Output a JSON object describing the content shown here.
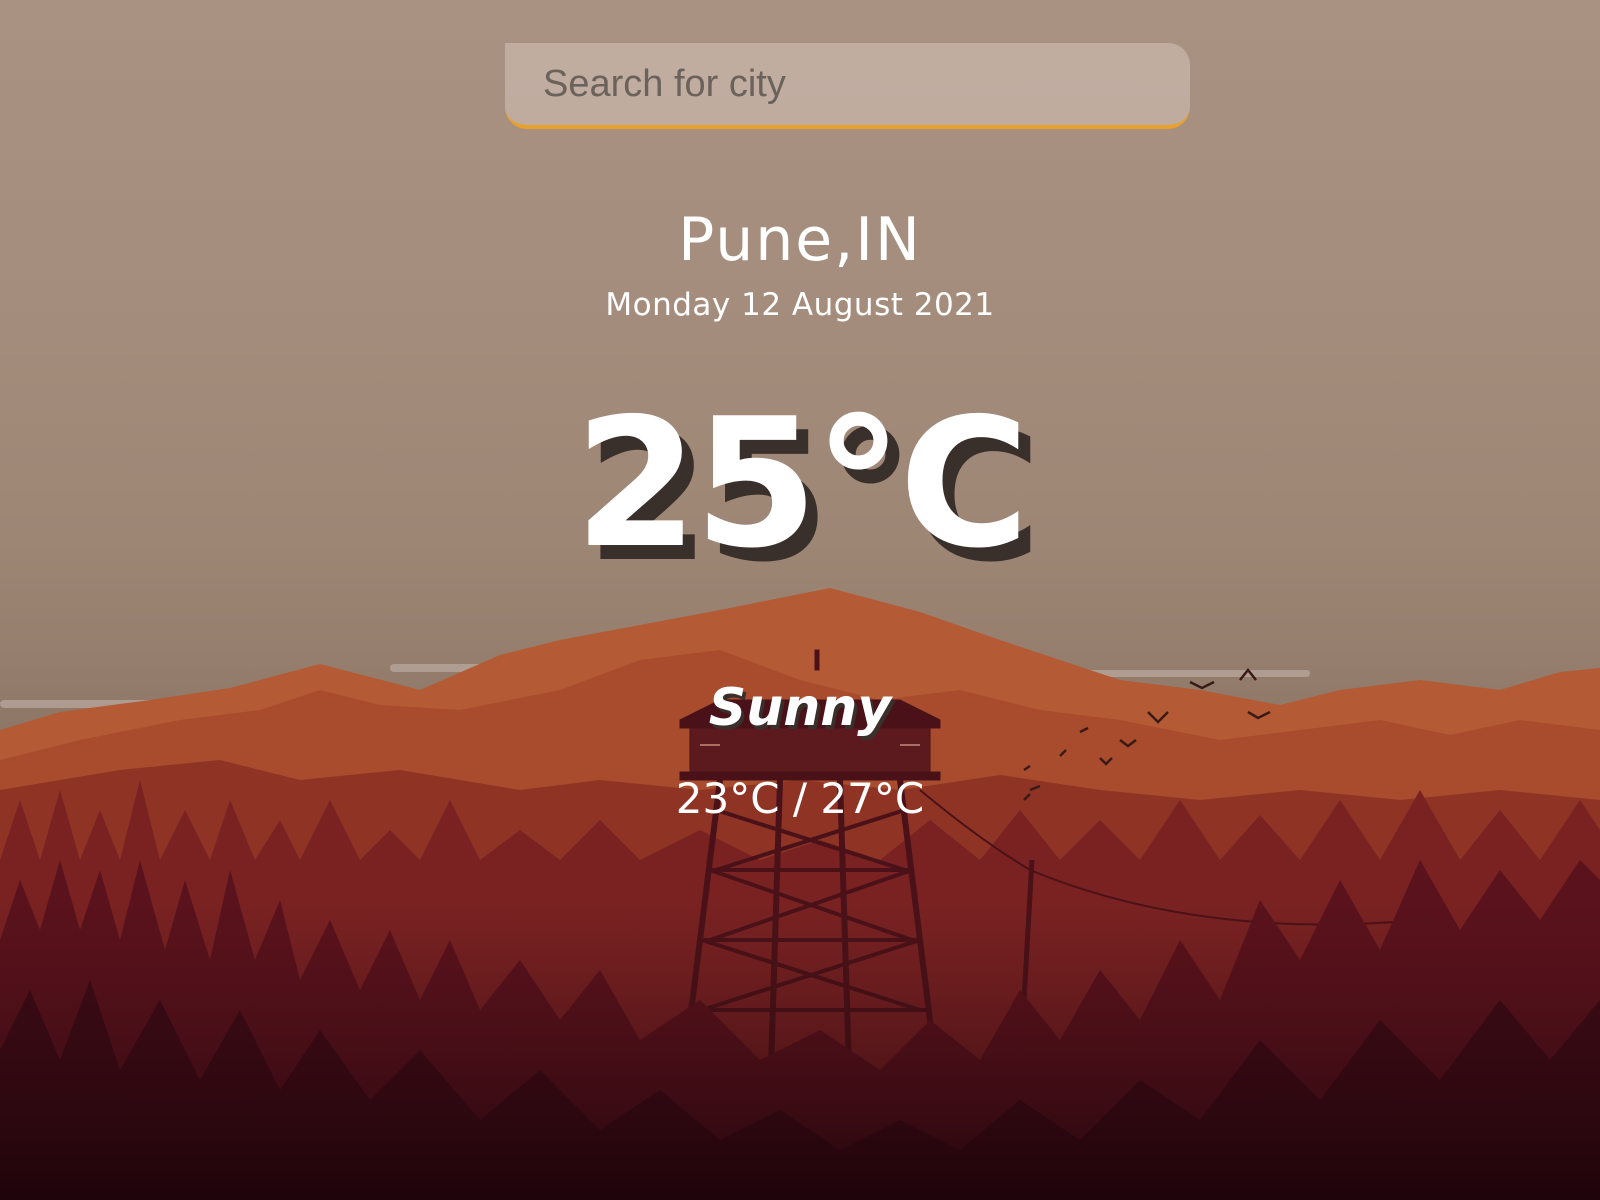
{
  "search": {
    "placeholder": "Search for city",
    "accent_color": "#e8a12d"
  },
  "location": {
    "city": "Pune,IN",
    "date": "Monday 12 August 2021"
  },
  "weather": {
    "temperature": "25°C",
    "condition": "Sunny",
    "range": "23°C / 27°C"
  },
  "background": {
    "scene": "mountain-forest-lookout-tower-illustration"
  }
}
